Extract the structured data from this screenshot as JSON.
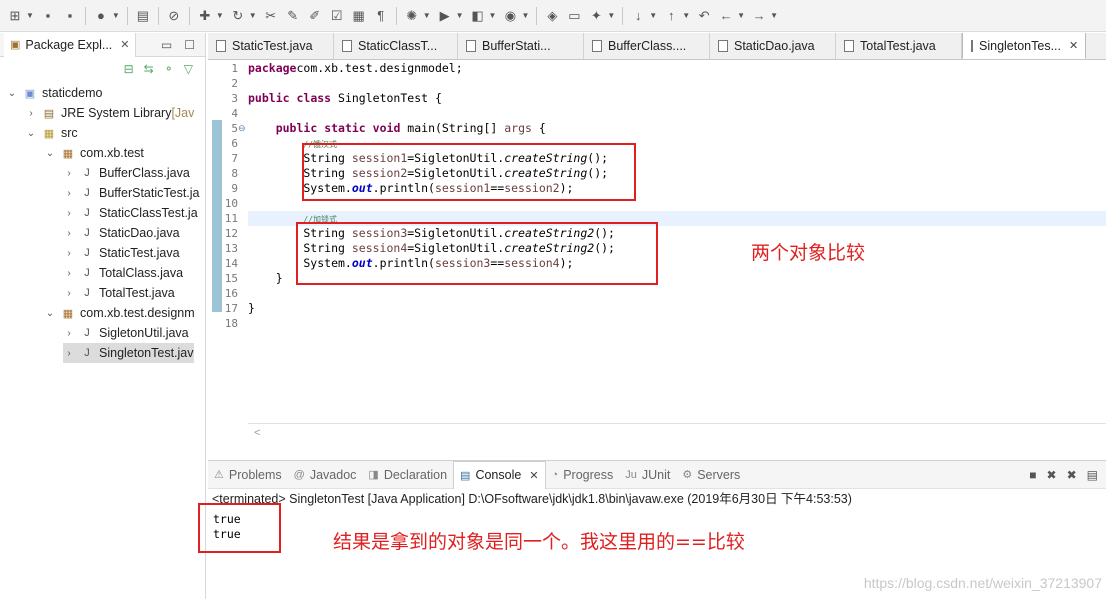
{
  "toolbar": {
    "icons": [
      "new-icon",
      "save-icon",
      "save-all-icon",
      "account-icon",
      "terminal-icon",
      "breakpoint-icon",
      "package-icon",
      "refresh-icon",
      "search-icon",
      "highlight-icon",
      "annotation-icon",
      "task-icon",
      "toggle-icon",
      "paragraph-icon",
      "debug-icon",
      "run-icon",
      "coverage-icon",
      "external-tools-icon",
      "open-type-icon",
      "open-folder-icon",
      "wand-icon",
      "next-annotation-icon",
      "prev-annotation-icon",
      "last-edit-icon",
      "back-icon",
      "forward-icon"
    ]
  },
  "package_explorer": {
    "title": "Package Expl...",
    "tree": [
      {
        "label": "staticdemo",
        "type": "proj",
        "depth": 0,
        "twisty": "open"
      },
      {
        "label": "JRE System Library",
        "suffix": " [Jav",
        "type": "lib",
        "depth": 1,
        "twisty": "closed"
      },
      {
        "label": "src",
        "type": "src",
        "depth": 1,
        "twisty": "open"
      },
      {
        "label": "com.xb.test",
        "type": "pkg",
        "depth": 2,
        "twisty": "open"
      },
      {
        "label": "BufferClass.java",
        "type": "file",
        "depth": 3,
        "twisty": "closed"
      },
      {
        "label": "BufferStaticTest.ja",
        "type": "file",
        "depth": 3,
        "twisty": "closed"
      },
      {
        "label": "StaticClassTest.ja",
        "type": "file",
        "depth": 3,
        "twisty": "closed"
      },
      {
        "label": "StaticDao.java",
        "type": "file",
        "depth": 3,
        "twisty": "closed"
      },
      {
        "label": "StaticTest.java",
        "type": "file",
        "depth": 3,
        "twisty": "closed"
      },
      {
        "label": "TotalClass.java",
        "type": "file",
        "depth": 3,
        "twisty": "closed"
      },
      {
        "label": "TotalTest.java",
        "type": "file",
        "depth": 3,
        "twisty": "closed"
      },
      {
        "label": "com.xb.test.designm",
        "type": "pkg",
        "depth": 2,
        "twisty": "open"
      },
      {
        "label": "SigletonUtil.java",
        "type": "file",
        "depth": 3,
        "twisty": "closed"
      },
      {
        "label": "SingletonTest.jav",
        "type": "file",
        "depth": 3,
        "twisty": "closed",
        "selected": true
      }
    ]
  },
  "editor": {
    "tabs": [
      {
        "label": "StaticTest.java",
        "active": false
      },
      {
        "label": "StaticClassT...",
        "active": false
      },
      {
        "label": "BufferStati...",
        "active": false
      },
      {
        "label": "BufferClass....",
        "active": false
      },
      {
        "label": "StaticDao.java",
        "active": false
      },
      {
        "label": "TotalTest.java",
        "active": false
      },
      {
        "label": "SingletonTes...",
        "active": true
      }
    ],
    "line_numbers": [
      "1",
      "2",
      "3",
      "4",
      "5",
      "6",
      "7",
      "8",
      "9",
      "10",
      "11",
      "12",
      "13",
      "14",
      "15",
      "16",
      "17",
      "18"
    ],
    "lines": [
      [
        [
          "kw",
          "package"
        ],
        [
          "",
          "com.xb.test.designmodel;"
        ]
      ],
      [],
      [
        [
          "kw",
          "public"
        ],
        [
          "",
          " "
        ],
        [
          "kw",
          "class"
        ],
        [
          "",
          " SingletonTest {"
        ]
      ],
      [],
      [
        [
          "",
          "    "
        ],
        [
          "kw",
          "public"
        ],
        [
          "",
          " "
        ],
        [
          "kw",
          "static"
        ],
        [
          "",
          " "
        ],
        [
          "kw",
          "void"
        ],
        [
          "",
          " main(String[] "
        ],
        [
          "var",
          "args"
        ],
        [
          "",
          " {"
        ]
      ],
      [
        [
          "",
          "        "
        ],
        [
          "cm",
          "//饿汉式"
        ]
      ],
      [
        [
          "",
          "        String "
        ],
        [
          "var",
          "session1"
        ],
        [
          "",
          "=SigletonUtil."
        ],
        [
          "it",
          "createString"
        ],
        [
          "",
          "();"
        ]
      ],
      [
        [
          "",
          "        String "
        ],
        [
          "var",
          "session2"
        ],
        [
          "",
          "=SigletonUtil."
        ],
        [
          "it",
          "createString"
        ],
        [
          "",
          "();"
        ]
      ],
      [
        [
          "",
          "        System."
        ],
        [
          "fld",
          "out"
        ],
        [
          "",
          ".println("
        ],
        [
          "var",
          "session1"
        ],
        [
          "",
          "=="
        ],
        [
          "var",
          "session2"
        ],
        [
          "",
          ");"
        ]
      ],
      [],
      [
        [
          "",
          "        "
        ],
        [
          "cm",
          "//加锁式"
        ]
      ],
      [
        [
          "",
          "        String "
        ],
        [
          "var",
          "session3"
        ],
        [
          "",
          "=SigletonUtil."
        ],
        [
          "it",
          "createString2"
        ],
        [
          "",
          "();"
        ]
      ],
      [
        [
          "",
          "        String "
        ],
        [
          "var",
          "session4"
        ],
        [
          "",
          "=SigletonUtil."
        ],
        [
          "it",
          "createString2"
        ],
        [
          "",
          "();"
        ]
      ],
      [
        [
          "",
          "        System."
        ],
        [
          "fld",
          "out"
        ],
        [
          "",
          ".println("
        ],
        [
          "var",
          "session3"
        ],
        [
          "",
          "=="
        ],
        [
          "var",
          "session4"
        ],
        [
          "",
          ");"
        ]
      ],
      [
        [
          "",
          "    }"
        ]
      ],
      [],
      [
        [
          "",
          "}"
        ]
      ],
      []
    ],
    "annotation": "两个对象比较"
  },
  "console": {
    "tabs": [
      {
        "label": "Problems",
        "icon": "problems-icon",
        "active": false
      },
      {
        "label": "Javadoc",
        "icon": "javadoc-icon",
        "active": false
      },
      {
        "label": "Declaration",
        "icon": "declaration-icon",
        "active": false
      },
      {
        "label": "Console",
        "icon": "console-icon",
        "active": true
      },
      {
        "label": "Progress",
        "icon": "progress-icon",
        "active": false
      },
      {
        "label": "JUnit",
        "icon": "junit-icon",
        "active": false
      },
      {
        "label": "Servers",
        "icon": "servers-icon",
        "active": false
      }
    ],
    "terminated": "<terminated> SingletonTest [Java Application] D:\\OFsoftware\\jdk\\jdk1.8\\bin\\javaw.exe (2019年6月30日 下午4:53:53)",
    "output": [
      "true",
      "true"
    ],
    "annotation": "结果是拿到的对象是同一个。我这里用的==比较"
  },
  "watermark": "https://blog.csdn.net/weixin_37213907"
}
